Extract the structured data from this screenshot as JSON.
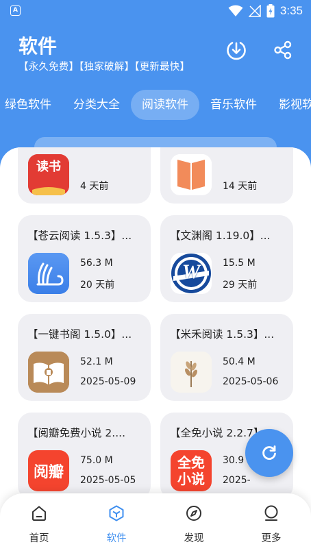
{
  "status_bar": {
    "time": "3:35",
    "left_icon_letter": "A"
  },
  "header": {
    "title": "软件",
    "subtitle": "【永久免费】【独家破解】【更新最快】"
  },
  "tabs": [
    {
      "label": "绿色软件",
      "active": false
    },
    {
      "label": "分类大全",
      "active": false
    },
    {
      "label": "阅读软件",
      "active": true
    },
    {
      "label": "音乐软件",
      "active": false
    },
    {
      "label": "影视软件",
      "active": false
    }
  ],
  "cards": [
    {
      "title": "",
      "size": "",
      "date": "4 天前",
      "icon": "dushu-book-icon",
      "icon_text": "读书"
    },
    {
      "title": "",
      "size": "",
      "date": "14 天前",
      "icon": "orange-book-icon",
      "icon_text": ""
    },
    {
      "title": "【苍云阅读 1.5.3】...",
      "size": "56.3 M",
      "date": "20 天前",
      "icon": "cloud-book-icon",
      "icon_text": ""
    },
    {
      "title": "【文渊阁 1.19.0】...",
      "size": "15.5 M",
      "date": "29 天前",
      "icon": "w-logo-icon",
      "icon_text": "W"
    },
    {
      "title": "【一键书阁 1.5.0】...",
      "size": "52.1 M",
      "date": "2025-05-09",
      "icon": "open-book-icon",
      "icon_text": ""
    },
    {
      "title": "【米禾阅读 1.5.3】...",
      "size": "50.4 M",
      "date": "2025-05-06",
      "icon": "wheat-icon",
      "icon_text": ""
    },
    {
      "title": "【阅瓣免费小说 2....",
      "size": "75.0 M",
      "date": "2025-05-05",
      "icon": "yueban-icon",
      "icon_text": "阅瓣"
    },
    {
      "title": "【全免小说 2.2.7】...",
      "size": "30.9 M",
      "date": "2025-",
      "icon": "quanmian-icon",
      "icon_text": "全免小说"
    }
  ],
  "bottom_nav": [
    {
      "label": "首页",
      "icon": "home-icon",
      "active": false
    },
    {
      "label": "软件",
      "icon": "software-cube-icon",
      "active": true
    },
    {
      "label": "发现",
      "icon": "compass-icon",
      "active": false
    },
    {
      "label": "更多",
      "icon": "more-user-icon",
      "active": false
    }
  ],
  "colors": {
    "primary": "#4a93ef",
    "card_bg": "#efeff3",
    "nav_active": "#3f8ff0"
  }
}
